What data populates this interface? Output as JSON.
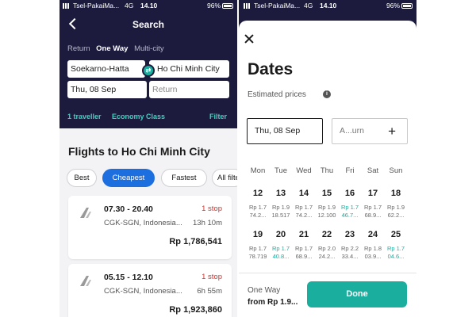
{
  "status": {
    "carrier": "Tsel-PakaiMa...",
    "network": "4G",
    "time": "14.10",
    "battery": "96%",
    "carrier_right": "Tsel-PakaiMa..."
  },
  "search": {
    "title": "Search",
    "trip_types": [
      "Return",
      "One Way",
      "Multi-city"
    ],
    "active_trip_type": "One Way",
    "origin": "Soekarno-Hatta",
    "destination": "Ho Chi Minh City",
    "depart": "Thu, 08 Sep",
    "return_placeholder": "Return",
    "travellers": "1 traveller",
    "cabin": "Economy Class",
    "filter": "Filter"
  },
  "results": {
    "title": "Flights to Ho Chi Minh City",
    "sort_chips": [
      "Best",
      "Cheapest",
      "Fastest",
      "All filte"
    ],
    "active_sort": "Cheapest",
    "flights": [
      {
        "time": "07.30 - 20.40",
        "stops": "1 stop",
        "route": "CGK-SGN, Indonesia...",
        "duration": "13h 10m",
        "price": "Rp 1,786,541"
      },
      {
        "time": "05.15 - 12.10",
        "stops": "1 stop",
        "route": "CGK-SGN, Indonesia...",
        "duration": "6h 55m",
        "price": "Rp 1,923,860"
      }
    ]
  },
  "dates": {
    "title": "Dates",
    "estimated": "Estimated prices",
    "depart": "Thu, 08 Sep",
    "return_placeholder": "A...urn",
    "weekdays": [
      "Mon",
      "Tue",
      "Wed",
      "Thu",
      "Fri",
      "Sat",
      "Sun"
    ],
    "weeks": [
      [
        {
          "day": "12",
          "p1": "Rp 1.7",
          "p2": "74.2...",
          "cheap": false
        },
        {
          "day": "13",
          "p1": "Rp 1.9",
          "p2": "18.517",
          "cheap": false
        },
        {
          "day": "14",
          "p1": "Rp 1.7",
          "p2": "74.2...",
          "cheap": false
        },
        {
          "day": "15",
          "p1": "Rp 1.9",
          "p2": "12.100",
          "cheap": false
        },
        {
          "day": "16",
          "p1": "Rp 1.7",
          "p2": "46.7...",
          "cheap": true
        },
        {
          "day": "17",
          "p1": "Rp 1.7",
          "p2": "68.9...",
          "cheap": false
        },
        {
          "day": "18",
          "p1": "Rp 1.9",
          "p2": "62.2...",
          "cheap": false
        }
      ],
      [
        {
          "day": "19",
          "p1": "Rp 1.7",
          "p2": "78.719",
          "cheap": false
        },
        {
          "day": "20",
          "p1": "Rp 1.7",
          "p2": "40.8...",
          "cheap": true
        },
        {
          "day": "21",
          "p1": "Rp 1.7",
          "p2": "68.9...",
          "cheap": false
        },
        {
          "day": "22",
          "p1": "Rp 2.0",
          "p2": "24.2...",
          "cheap": false
        },
        {
          "day": "23",
          "p1": "Rp 2.2",
          "p2": "33.4...",
          "cheap": false
        },
        {
          "day": "24",
          "p1": "Rp 1.8",
          "p2": "03.9...",
          "cheap": false
        },
        {
          "day": "25",
          "p1": "Rp 1.7",
          "p2": "04.6...",
          "cheap": true
        }
      ]
    ],
    "trip_label": "One Way",
    "from_price": "from Rp 1.9...",
    "done": "Done"
  },
  "colors": {
    "navy": "#1c1b3d",
    "teal": "#1aae9f",
    "blue": "#1d6fe0",
    "red": "#d0312d"
  }
}
